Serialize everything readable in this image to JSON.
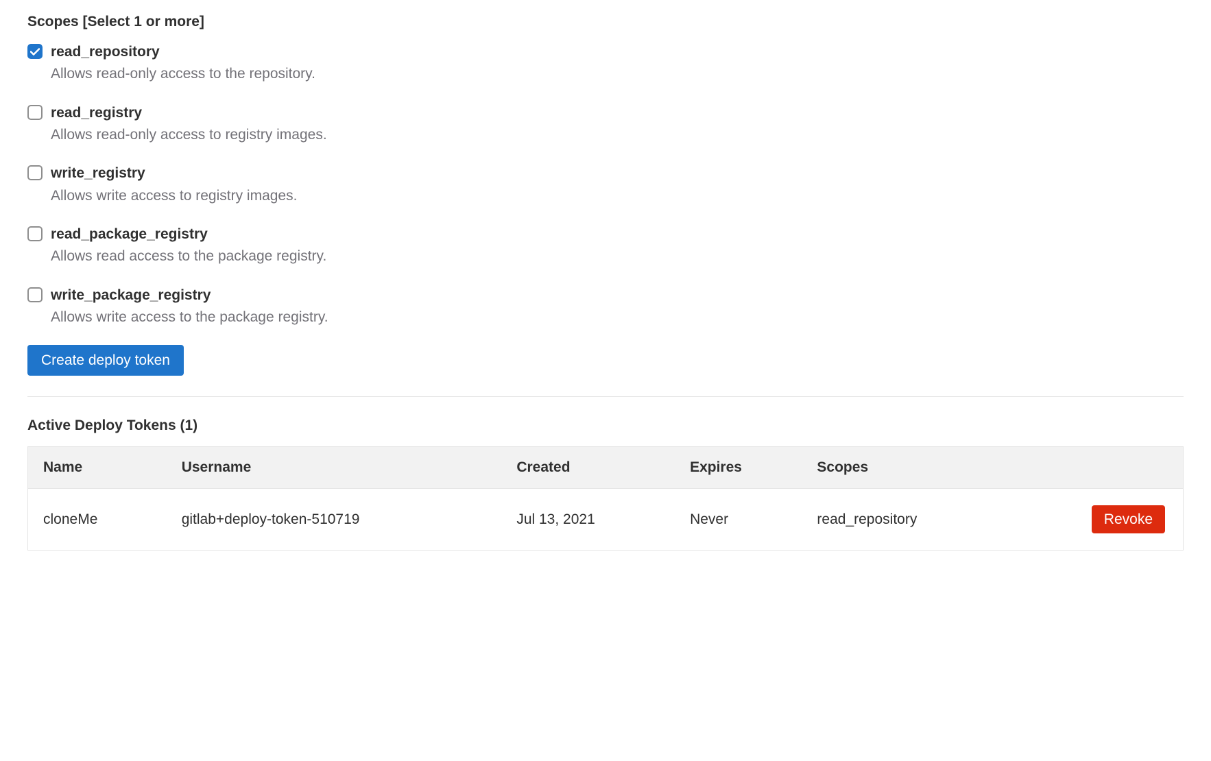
{
  "scopes": {
    "title": "Scopes [Select 1 or more]",
    "items": [
      {
        "label": "read_repository",
        "desc": "Allows read-only access to the repository.",
        "checked": true
      },
      {
        "label": "read_registry",
        "desc": "Allows read-only access to registry images.",
        "checked": false
      },
      {
        "label": "write_registry",
        "desc": "Allows write access to registry images.",
        "checked": false
      },
      {
        "label": "read_package_registry",
        "desc": "Allows read access to the package registry.",
        "checked": false
      },
      {
        "label": "write_package_registry",
        "desc": "Allows write access to the package registry.",
        "checked": false
      }
    ],
    "create_button": "Create deploy token"
  },
  "tokens": {
    "title": "Active Deploy Tokens (1)",
    "headers": {
      "name": "Name",
      "username": "Username",
      "created": "Created",
      "expires": "Expires",
      "scopes": "Scopes"
    },
    "rows": [
      {
        "name": "cloneMe",
        "username": "gitlab+deploy-token-510719",
        "created": "Jul 13, 2021",
        "expires": "Never",
        "scopes": "read_repository",
        "revoke": "Revoke"
      }
    ]
  }
}
